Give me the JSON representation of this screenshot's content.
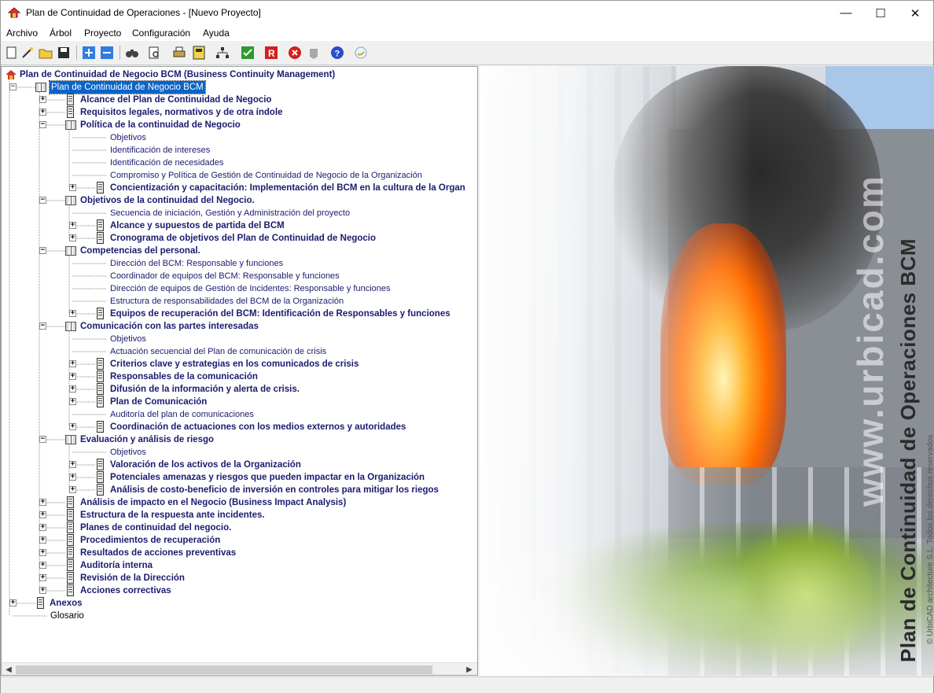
{
  "window": {
    "title": "Plan de Continuidad de Operaciones - [Nuevo Proyecto]",
    "minimize": "—",
    "maximize": "☐",
    "close": "✕"
  },
  "menu": [
    "Archivo",
    "Árbol",
    "Proyecto",
    "Configuración",
    "Ayuda"
  ],
  "toolbar_icons": [
    "new-doc-icon",
    "open-wand-icon",
    "open-folder-icon",
    "save-icon",
    "expand-plus-icon",
    "collapse-minus-icon",
    "binoculars-icon",
    "preview-icon",
    "print-icon",
    "calc-icon",
    "tree-structure-icon",
    "check-icon",
    "r-icon",
    "stop-icon",
    "gray-icon",
    "help-icon",
    "info-icon"
  ],
  "tree": {
    "root": "Plan de Continuidad de Negocio BCM (Business Continuity Management)",
    "items": [
      {
        "text": "Plan de Continuidad de Negocio BCM",
        "level": 1,
        "type": "book",
        "pm": "−",
        "style": "sel"
      },
      {
        "text": "Alcance del Plan de Continuidad de Negocio",
        "level": 2,
        "type": "doc",
        "pm": "+",
        "style": "bold"
      },
      {
        "text": "Requisitos legales, normativos y de otra índole",
        "level": 2,
        "type": "doc",
        "pm": "+",
        "style": "bold"
      },
      {
        "text": "Política de la continuidad de Negocio",
        "level": 2,
        "type": "book",
        "pm": "−",
        "style": "bold"
      },
      {
        "text": "Objetivos",
        "level": 3,
        "type": "none",
        "pm": "",
        "style": "light"
      },
      {
        "text": "Identificación de intereses",
        "level": 3,
        "type": "none",
        "pm": "",
        "style": "light"
      },
      {
        "text": "Identificación de necesidades",
        "level": 3,
        "type": "none",
        "pm": "",
        "style": "light"
      },
      {
        "text": "Compromiso y Política de Gestión de Continuidad de Negocio de la Organización",
        "level": 3,
        "type": "none",
        "pm": "",
        "style": "light"
      },
      {
        "text": "Concientización y capacitación: Implementación del BCM en la cultura de la Organ",
        "level": 3,
        "type": "doc",
        "pm": "+",
        "style": "bold"
      },
      {
        "text": "Objetivos de la continuidad del Negocio.",
        "level": 2,
        "type": "book",
        "pm": "−",
        "style": "bold"
      },
      {
        "text": "Secuencia de iniciación, Gestión y Administración del proyecto",
        "level": 3,
        "type": "none",
        "pm": "",
        "style": "light"
      },
      {
        "text": "Alcance y supuestos de partida del BCM",
        "level": 3,
        "type": "doc",
        "pm": "+",
        "style": "bold"
      },
      {
        "text": "Cronograma de objetivos del Plan de Continuidad de Negocio",
        "level": 3,
        "type": "doc",
        "pm": "+",
        "style": "bold"
      },
      {
        "text": "Competencias del personal.",
        "level": 2,
        "type": "book",
        "pm": "−",
        "style": "bold"
      },
      {
        "text": "Dirección del BCM: Responsable y funciones",
        "level": 3,
        "type": "none",
        "pm": "",
        "style": "light"
      },
      {
        "text": "Coordinador de equipos del BCM: Responsable y funciones",
        "level": 3,
        "type": "none",
        "pm": "",
        "style": "light"
      },
      {
        "text": "Dirección de equipos de Gestión de Incidentes: Responsable y funciones",
        "level": 3,
        "type": "none",
        "pm": "",
        "style": "light"
      },
      {
        "text": "Estructura de responsabilidades del BCM de la Organización",
        "level": 3,
        "type": "none",
        "pm": "",
        "style": "light"
      },
      {
        "text": "Equipos de recuperación del BCM: Identificación de Responsables y funciones",
        "level": 3,
        "type": "doc",
        "pm": "+",
        "style": "bold"
      },
      {
        "text": "Comunicación con las partes interesadas",
        "level": 2,
        "type": "book",
        "pm": "−",
        "style": "bold"
      },
      {
        "text": "Objetivos",
        "level": 3,
        "type": "none",
        "pm": "",
        "style": "light"
      },
      {
        "text": "Actuación secuencial del Plan de comunicación de crisis",
        "level": 3,
        "type": "none",
        "pm": "",
        "style": "light"
      },
      {
        "text": "Criterios clave y estrategias en los comunicados de crisis",
        "level": 3,
        "type": "doc",
        "pm": "+",
        "style": "bold"
      },
      {
        "text": "Responsables de la comunicación",
        "level": 3,
        "type": "doc",
        "pm": "+",
        "style": "bold"
      },
      {
        "text": "Difusión de la información y alerta de crisis.",
        "level": 3,
        "type": "doc",
        "pm": "+",
        "style": "bold"
      },
      {
        "text": "Plan de Comunicación",
        "level": 3,
        "type": "doc",
        "pm": "+",
        "style": "bold"
      },
      {
        "text": "Auditoría del plan de comunicaciones",
        "level": 3,
        "type": "none",
        "pm": "",
        "style": "light"
      },
      {
        "text": "Coordinación de actuaciones con los medios externos y autoridades",
        "level": 3,
        "type": "doc",
        "pm": "+",
        "style": "bold"
      },
      {
        "text": "Evaluación y análisis de riesgo",
        "level": 2,
        "type": "book",
        "pm": "−",
        "style": "bold"
      },
      {
        "text": "Objetivos",
        "level": 3,
        "type": "none",
        "pm": "",
        "style": "light"
      },
      {
        "text": "Valoración de los activos de la Organización",
        "level": 3,
        "type": "doc",
        "pm": "+",
        "style": "bold"
      },
      {
        "text": "Potenciales amenazas y riesgos que pueden impactar en la Organización",
        "level": 3,
        "type": "doc",
        "pm": "+",
        "style": "bold"
      },
      {
        "text": "Análisis de costo-beneficio de inversión en controles para mitigar los riegos",
        "level": 3,
        "type": "doc",
        "pm": "+",
        "style": "bold"
      },
      {
        "text": "Análisis de impacto en el Negocio (Business Impact Analysis)",
        "level": 2,
        "type": "doc",
        "pm": "+",
        "style": "bold"
      },
      {
        "text": "Estructura de la respuesta ante incidentes.",
        "level": 2,
        "type": "doc",
        "pm": "+",
        "style": "bold"
      },
      {
        "text": "Planes de continuidad del negocio.",
        "level": 2,
        "type": "doc",
        "pm": "+",
        "style": "bold"
      },
      {
        "text": "Procedimientos de recuperación",
        "level": 2,
        "type": "doc",
        "pm": "+",
        "style": "bold"
      },
      {
        "text": "Resultados de acciones preventivas",
        "level": 2,
        "type": "doc",
        "pm": "+",
        "style": "bold"
      },
      {
        "text": "Auditoría interna",
        "level": 2,
        "type": "doc",
        "pm": "+",
        "style": "bold"
      },
      {
        "text": "Revisión de la Dirección",
        "level": 2,
        "type": "doc",
        "pm": "+",
        "style": "bold"
      },
      {
        "text": "Acciones correctivas",
        "level": 2,
        "type": "doc",
        "pm": "+",
        "style": "bold"
      },
      {
        "text": "Anexos",
        "level": 1,
        "type": "doc",
        "pm": "+",
        "style": "bold"
      },
      {
        "text": "Glosario",
        "level": 1,
        "type": "none",
        "pm": "",
        "style": "plain"
      }
    ]
  },
  "watermark": {
    "site": "www.urbicad.com",
    "title": "Plan de Continuidad de Operaciones BCM",
    "copyright": "© UrbiCAD architecture S.L. Todos los derechos reservados"
  },
  "colors": {
    "selection": "#0a64c8",
    "tree_text": "#1b1b6f"
  }
}
